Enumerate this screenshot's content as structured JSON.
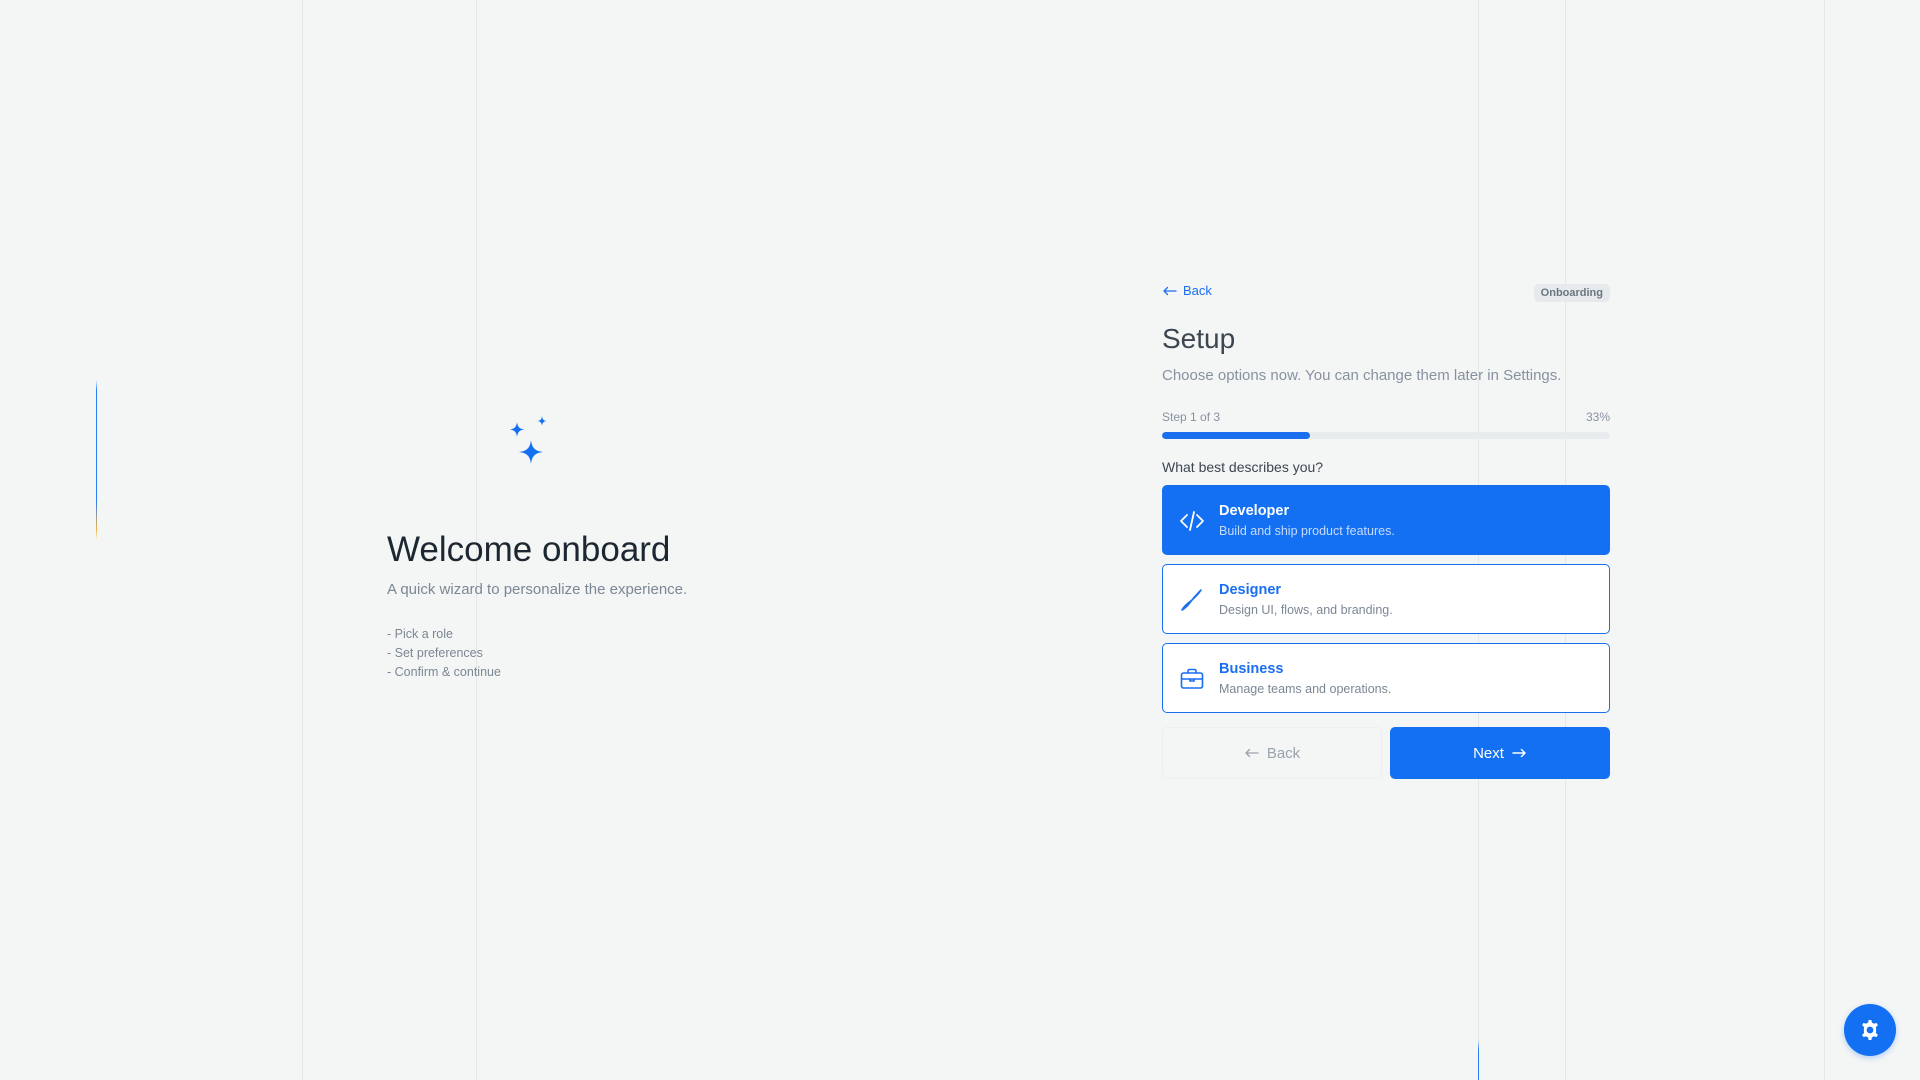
{
  "hero": {
    "icon": "sparkles-icon",
    "title": "Welcome onboard",
    "subtitle": "A quick wizard to personalize the experience.",
    "steps": [
      "- Pick a role",
      "- Set preferences",
      "- Confirm & continue"
    ]
  },
  "panel": {
    "back_link": "Back",
    "badge": "Onboarding",
    "title": "Setup",
    "subtitle": "Choose options now. You can change them later in Settings.",
    "progress": {
      "step_label": "Step 1 of 3",
      "percent_label": "33%",
      "value": 0.33
    },
    "question": "What best describes you?",
    "options": [
      {
        "title": "Developer",
        "desc": "Build and ship product features.",
        "icon": "code-icon",
        "selected": true
      },
      {
        "title": "Designer",
        "desc": "Design UI, flows, and branding.",
        "icon": "brush-icon",
        "selected": false
      },
      {
        "title": "Business",
        "desc": "Manage teams and operations.",
        "icon": "briefcase-icon",
        "selected": false
      }
    ],
    "back_button": "Back",
    "next_button": "Next"
  },
  "fab": {
    "icon": "gear-icon"
  },
  "colors": {
    "accent": "#1370f2",
    "background": "#f4f6f5"
  }
}
